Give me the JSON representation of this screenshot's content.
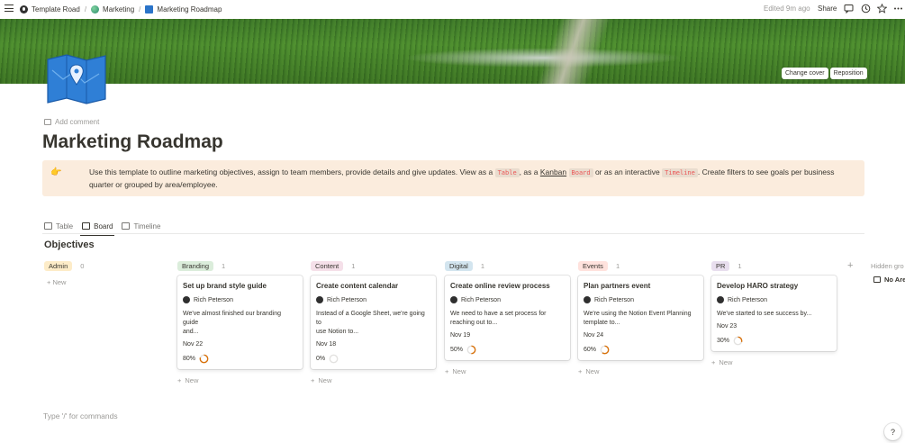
{
  "breadcrumbs": [
    "Template Road",
    "Marketing",
    "Marketing Roadmap"
  ],
  "topbar": {
    "edited": "Edited 9m ago",
    "share": "Share"
  },
  "cover": {
    "change_cover": "Change cover",
    "reposition": "Reposition"
  },
  "add_comment": "Add comment",
  "title": "Marketing Roadmap",
  "callout": {
    "emoji": "👉",
    "t1": "Use this template to outline marketing objectives, assign to team members, provide details and give updates. View as a ",
    "code1": "Table",
    "t2": ", as a ",
    "kanban": "Kanban",
    "code2": "Board",
    "t3": " or as an interactive ",
    "code3": "Timeline",
    "t4": ". Create filters to see goals per business quarter or grouped by area/employee."
  },
  "tabs": [
    "Table",
    "Board",
    "Timeline"
  ],
  "section_title": "Objectives",
  "columns": [
    {
      "label": "Admin",
      "count": "0",
      "color": "#fdecc8"
    },
    {
      "label": "Branding",
      "count": "1",
      "color": "#dbeddb"
    },
    {
      "label": "Content",
      "count": "1",
      "color": "#f5e0e9"
    },
    {
      "label": "Digital",
      "count": "1",
      "color": "#d3e5ef"
    },
    {
      "label": "Events",
      "count": "1",
      "color": "#ffe2dd"
    },
    {
      "label": "PR",
      "count": "1",
      "color": "#e8deee"
    }
  ],
  "cards": [
    {
      "title": "Set up brand style guide",
      "person": "Rich Peterson",
      "desc1": "We've almost finished our branding guide",
      "desc2": "and...",
      "date": "Nov 22",
      "progress": "80%",
      "pct": 80
    },
    {
      "title": "Create content calendar",
      "person": "Rich Peterson",
      "desc1": "Instead of a Google Sheet, we're going to",
      "desc2": "use Notion to...",
      "date": "Nov 18",
      "progress": "0%",
      "pct": 0
    },
    {
      "title": "Create online review process",
      "person": "Rich Peterson",
      "desc1": "We need to have a set process for",
      "desc2": "reaching out to...",
      "date": "Nov 19",
      "progress": "50%",
      "pct": 50
    },
    {
      "title": "Plan partners event",
      "person": "Rich Peterson",
      "desc1": "We're using the Notion Event Planning",
      "desc2": "template to...",
      "date": "Nov 24",
      "progress": "60%",
      "pct": 60
    },
    {
      "title": "Develop HARO strategy",
      "person": "Rich Peterson",
      "desc1": "We've started to see success by...",
      "desc2": "",
      "date": "Nov 23",
      "progress": "30%",
      "pct": 30
    }
  ],
  "new_label": "New",
  "hidden_groups": "Hidden gro",
  "no_area": "No Are",
  "commands_hint": "Type '/' for commands",
  "help": "?",
  "colors": {
    "callout_bg": "#fbecdd",
    "progress": "#d9730d",
    "code": "#eb5757"
  }
}
